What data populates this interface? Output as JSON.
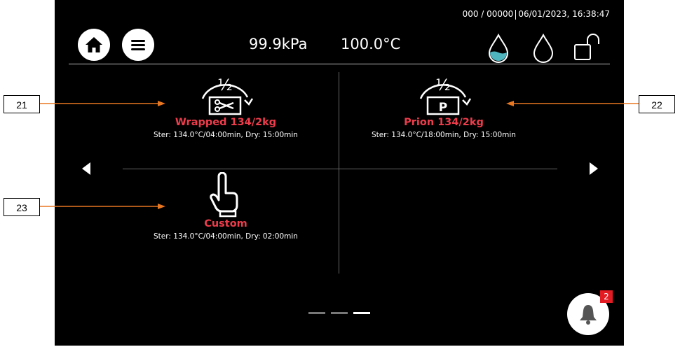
{
  "status": {
    "counter": "000 / 00000",
    "datetime": "06/01/2023, 16:38:47"
  },
  "header": {
    "pressure": "99.9kPa",
    "temperature": "100.0°C"
  },
  "programs": [
    {
      "name": "Wrapped 134/2kg",
      "detail": "Ster: 134.0°C/04:00min, Dry: 15:00min",
      "icon": "half-scissors-icon"
    },
    {
      "name": "Prion 134/2kg",
      "detail": "Ster: 134.0°C/18:00min, Dry: 15:00min",
      "icon": "half-prion-icon"
    },
    {
      "name": "Custom",
      "detail": "Ster: 134.0°C/04:00min, Dry: 02:00min",
      "icon": "hand-pointer-icon"
    }
  ],
  "icon_half_label": "½",
  "icon_p_label": "P",
  "pager": {
    "pages": 3,
    "active": 3
  },
  "notifications": {
    "count": "2"
  },
  "callouts": [
    "21",
    "22",
    "23"
  ],
  "colors": {
    "accent": "#ee3c4b",
    "water": "#4fb6c0",
    "badge": "#e31b23",
    "callout_line": "#e87722"
  }
}
